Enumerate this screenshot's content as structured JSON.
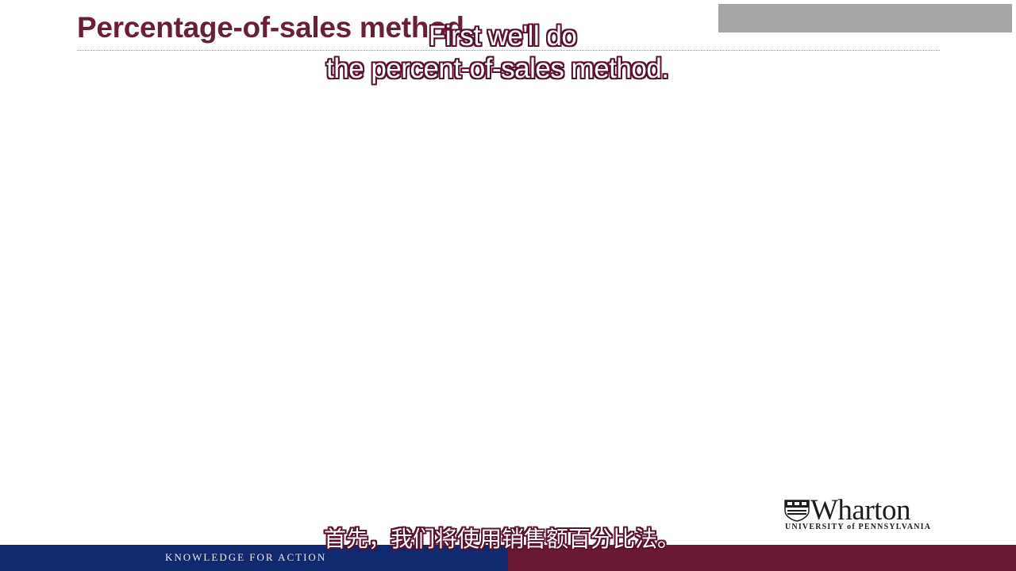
{
  "slide": {
    "title": "Percentage-of-sales method",
    "footer_tagline": "KNOWLEDGE FOR ACTION"
  },
  "captions": {
    "english_line1": "First we'll do",
    "english_line2": "the percent-of-sales method.",
    "chinese": "首先，我们将使用销售额百分比法。"
  },
  "logo": {
    "name": "Wharton",
    "subtitle": "UNIVERSITY of PENNSYLVANIA",
    "icon": "penn-shield-icon"
  },
  "colors": {
    "title": "#6b1f36",
    "footer_blue": "#0f2a6e",
    "footer_red": "#6a1934",
    "caption_outline": "#5a1030",
    "overlay_box": "#a5a5a5"
  }
}
